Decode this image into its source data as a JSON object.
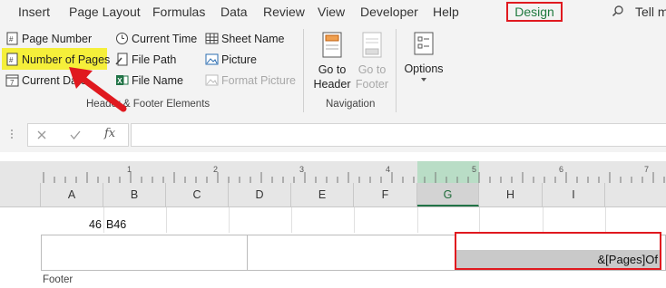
{
  "menu": {
    "items": [
      "Insert",
      "Page Layout",
      "Formulas",
      "Data",
      "Review",
      "View",
      "Developer",
      "Help"
    ],
    "active_tab": "Design",
    "tell_me": "Tell m"
  },
  "ribbon": {
    "header_footer_elements": {
      "page_number": "Page Number",
      "number_of_pages": "Number of Pages",
      "current_date": "Current Date",
      "current_time": "Current Time",
      "file_path": "File Path",
      "file_name": "File Name",
      "sheet_name": "Sheet Name",
      "picture": "Picture",
      "format_picture": "Format Picture",
      "group_label": "Header & Footer Elements"
    },
    "navigation": {
      "go_to_header": "Go to Header",
      "go_to_footer": "Go to Footer",
      "group_label": "Navigation"
    },
    "options": {
      "label": "Options"
    }
  },
  "formula_bar": {
    "fx": "fx"
  },
  "ruler": {
    "numbers": [
      "1",
      "2",
      "3",
      "4",
      "5",
      "6",
      "7"
    ]
  },
  "columns": [
    "A",
    "B",
    "C",
    "D",
    "E",
    "F",
    "G",
    "H",
    "I"
  ],
  "active_column": "G",
  "sheet": {
    "cell_a": "46",
    "cell_b": "B46",
    "footer_code": "&[Pages]Of",
    "footer_label": "Footer"
  },
  "colors": {
    "accent_green": "#217346",
    "highlight_yellow": "#f5ef3a",
    "annotation_red": "#e0191f"
  }
}
